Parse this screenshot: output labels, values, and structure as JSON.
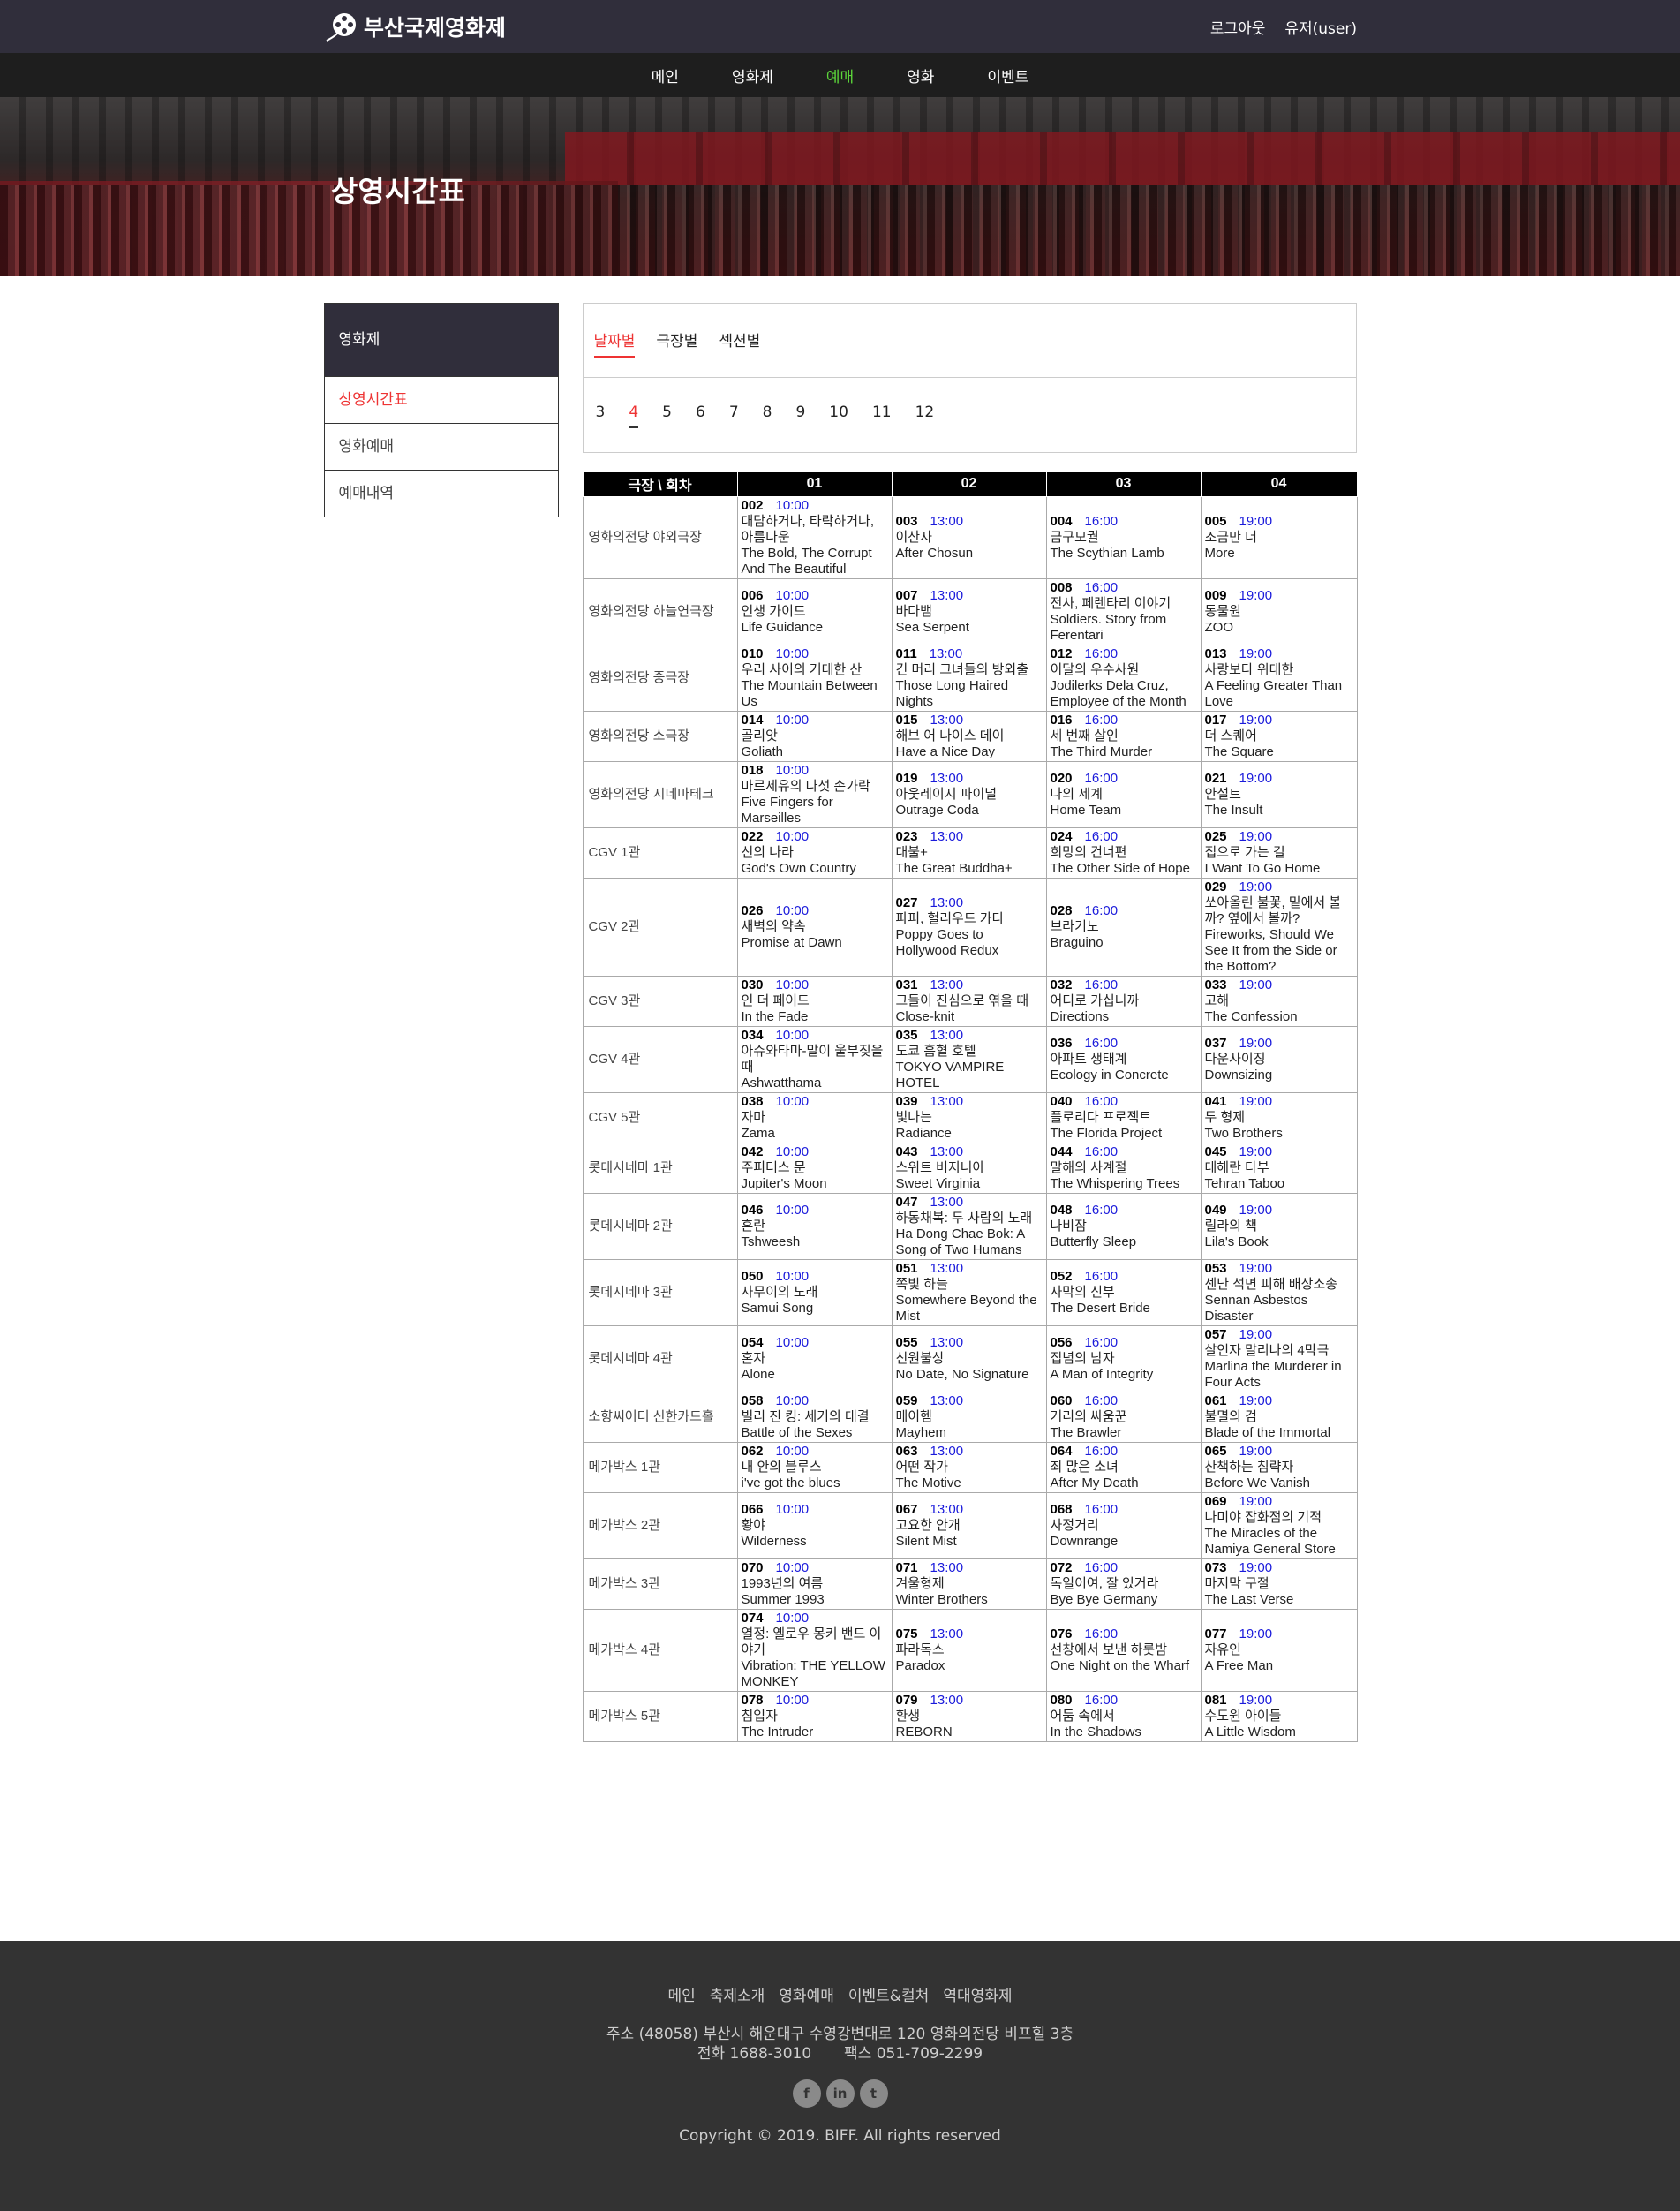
{
  "header": {
    "logo_text": "부산국제영화제",
    "logout": "로그아웃",
    "user": "유저(user)"
  },
  "nav": [
    "메인",
    "영화제",
    "예매",
    "영화",
    "이벤트"
  ],
  "nav_active": "예매",
  "banner_title": "상영시간표",
  "sidebar": {
    "title": "영화제",
    "items": [
      "상영시간표",
      "영화예매",
      "예매내역"
    ]
  },
  "tabs": [
    "날짜별",
    "극장별",
    "섹션별"
  ],
  "dates": [
    "3",
    "4",
    "5",
    "6",
    "7",
    "8",
    "9",
    "10",
    "11",
    "12"
  ],
  "schedule": {
    "headers": [
      "극장 \\ 회차",
      "01",
      "02",
      "03",
      "04"
    ],
    "rows": [
      {
        "theater": "영화의전당 야외극장",
        "cells": [
          {
            "code": "002",
            "time": "10:00",
            "ko": "대담하거나, 타락하거나, 아름다운",
            "en": "The Bold, The Corrupt And The Beautiful"
          },
          {
            "code": "003",
            "time": "13:00",
            "ko": "이산자",
            "en": "After Chosun"
          },
          {
            "code": "004",
            "time": "16:00",
            "ko": "금구모궐",
            "en": "The Scythian Lamb"
          },
          {
            "code": "005",
            "time": "19:00",
            "ko": "조금만 더",
            "en": "More"
          }
        ]
      },
      {
        "theater": "영화의전당 하늘연극장",
        "cells": [
          {
            "code": "006",
            "time": "10:00",
            "ko": "인생 가이드",
            "en": "Life Guidance"
          },
          {
            "code": "007",
            "time": "13:00",
            "ko": "바다뱀",
            "en": "Sea Serpent"
          },
          {
            "code": "008",
            "time": "16:00",
            "ko": "전사, 페렌타리 이야기",
            "en": "Soldiers. Story from Ferentari"
          },
          {
            "code": "009",
            "time": "19:00",
            "ko": "동물원",
            "en": "ZOO"
          }
        ]
      },
      {
        "theater": "영화의전당 중극장",
        "cells": [
          {
            "code": "010",
            "time": "10:00",
            "ko": "우리 사이의 거대한 산",
            "en": "The Mountain Between Us"
          },
          {
            "code": "011",
            "time": "13:00",
            "ko": "긴 머리 그녀들의 방외출",
            "en": "Those Long Haired Nights"
          },
          {
            "code": "012",
            "time": "16:00",
            "ko": "이달의 우수사원",
            "en": "Jodilerks Dela Cruz, Employee of the Month"
          },
          {
            "code": "013",
            "time": "19:00",
            "ko": "사랑보다 위대한",
            "en": "A Feeling Greater Than Love"
          }
        ]
      },
      {
        "theater": "영화의전당 소극장",
        "cells": [
          {
            "code": "014",
            "time": "10:00",
            "ko": "골리앗",
            "en": "Goliath"
          },
          {
            "code": "015",
            "time": "13:00",
            "ko": "해브 어 나이스 데이",
            "en": "Have a Nice Day"
          },
          {
            "code": "016",
            "time": "16:00",
            "ko": "세 번째 살인",
            "en": "The Third Murder"
          },
          {
            "code": "017",
            "time": "19:00",
            "ko": "더 스퀘어",
            "en": "The Square"
          }
        ]
      },
      {
        "theater": "영화의전당 시네마테크",
        "cells": [
          {
            "code": "018",
            "time": "10:00",
            "ko": "마르세유의 다섯 손가락",
            "en": "Five Fingers for Marseilles"
          },
          {
            "code": "019",
            "time": "13:00",
            "ko": "아웃레이지 파이널",
            "en": "Outrage Coda"
          },
          {
            "code": "020",
            "time": "16:00",
            "ko": "나의 세계",
            "en": "Home Team"
          },
          {
            "code": "021",
            "time": "19:00",
            "ko": "안설트",
            "en": "The Insult"
          }
        ]
      },
      {
        "theater": "CGV 1관",
        "cells": [
          {
            "code": "022",
            "time": "10:00",
            "ko": "신의 나라",
            "en": "God's Own Country"
          },
          {
            "code": "023",
            "time": "13:00",
            "ko": "대불+",
            "en": "The Great Buddha+"
          },
          {
            "code": "024",
            "time": "16:00",
            "ko": "희망의 건너편",
            "en": "The Other Side of Hope"
          },
          {
            "code": "025",
            "time": "19:00",
            "ko": "집으로 가는 길",
            "en": "I Want To Go Home"
          }
        ]
      },
      {
        "theater": "CGV 2관",
        "cells": [
          {
            "code": "026",
            "time": "10:00",
            "ko": "새벽의 약속",
            "en": "Promise at Dawn"
          },
          {
            "code": "027",
            "time": "13:00",
            "ko": "파피, 헐리우드 가다",
            "en": "Poppy Goes to Hollywood Redux"
          },
          {
            "code": "028",
            "time": "16:00",
            "ko": "브라기노",
            "en": "Braguino"
          },
          {
            "code": "029",
            "time": "19:00",
            "ko": "쏘아올린 불꽃, 밑에서 볼까? 옆에서 볼까?",
            "en": "Fireworks, Should We See It from the Side or the Bottom?"
          }
        ]
      },
      {
        "theater": "CGV 3관",
        "cells": [
          {
            "code": "030",
            "time": "10:00",
            "ko": "인 더 페이드",
            "en": "In the Fade"
          },
          {
            "code": "031",
            "time": "13:00",
            "ko": "그들이 진심으로 엮을 때",
            "en": "Close-knit"
          },
          {
            "code": "032",
            "time": "16:00",
            "ko": "어디로 가십니까",
            "en": "Directions"
          },
          {
            "code": "033",
            "time": "19:00",
            "ko": "고해",
            "en": "The Confession"
          }
        ]
      },
      {
        "theater": "CGV 4관",
        "cells": [
          {
            "code": "034",
            "time": "10:00",
            "ko": "아슈와타마-말이 울부짖을 때",
            "en": "Ashwatthama"
          },
          {
            "code": "035",
            "time": "13:00",
            "ko": "도쿄 흡혈 호텔",
            "en": "TOKYO VAMPIRE HOTEL"
          },
          {
            "code": "036",
            "time": "16:00",
            "ko": "아파트 생태계",
            "en": "Ecology in Concrete"
          },
          {
            "code": "037",
            "time": "19:00",
            "ko": "다운사이징",
            "en": "Downsizing"
          }
        ]
      },
      {
        "theater": "CGV 5관",
        "cells": [
          {
            "code": "038",
            "time": "10:00",
            "ko": "자마",
            "en": "Zama"
          },
          {
            "code": "039",
            "time": "13:00",
            "ko": "빛나는",
            "en": "Radiance"
          },
          {
            "code": "040",
            "time": "16:00",
            "ko": "플로리다 프로젝트",
            "en": "The Florida Project"
          },
          {
            "code": "041",
            "time": "19:00",
            "ko": "두 형제",
            "en": "Two Brothers"
          }
        ]
      },
      {
        "theater": "롯데시네마 1관",
        "cells": [
          {
            "code": "042",
            "time": "10:00",
            "ko": "주피터스 문",
            "en": "Jupiter's Moon"
          },
          {
            "code": "043",
            "time": "13:00",
            "ko": "스위트 버지니아",
            "en": "Sweet Virginia"
          },
          {
            "code": "044",
            "time": "16:00",
            "ko": "말해의 사계절",
            "en": "The Whispering Trees"
          },
          {
            "code": "045",
            "time": "19:00",
            "ko": "테헤란 타부",
            "en": "Tehran Taboo"
          }
        ]
      },
      {
        "theater": "롯데시네마 2관",
        "cells": [
          {
            "code": "046",
            "time": "10:00",
            "ko": "혼란",
            "en": "Tshweesh"
          },
          {
            "code": "047",
            "time": "13:00",
            "ko": "하동채복: 두 사람의 노래",
            "en": "Ha Dong Chae Bok: A Song of Two Humans"
          },
          {
            "code": "048",
            "time": "16:00",
            "ko": "나비잠",
            "en": "Butterfly Sleep"
          },
          {
            "code": "049",
            "time": "19:00",
            "ko": "릴라의 책",
            "en": "Lila's Book"
          }
        ]
      },
      {
        "theater": "롯데시네마 3관",
        "cells": [
          {
            "code": "050",
            "time": "10:00",
            "ko": "사무이의 노래",
            "en": "Samui Song"
          },
          {
            "code": "051",
            "time": "13:00",
            "ko": "쪽빛 하늘",
            "en": "Somewhere Beyond the Mist"
          },
          {
            "code": "052",
            "time": "16:00",
            "ko": "사막의 신부",
            "en": "The Desert Bride"
          },
          {
            "code": "053",
            "time": "19:00",
            "ko": "센난 석면 피해 배상소송",
            "en": "Sennan Asbestos Disaster"
          }
        ]
      },
      {
        "theater": "롯데시네마 4관",
        "cells": [
          {
            "code": "054",
            "time": "10:00",
            "ko": "혼자",
            "en": "Alone"
          },
          {
            "code": "055",
            "time": "13:00",
            "ko": "신원불상",
            "en": "No Date, No Signature"
          },
          {
            "code": "056",
            "time": "16:00",
            "ko": "집념의 남자",
            "en": "A Man of Integrity"
          },
          {
            "code": "057",
            "time": "19:00",
            "ko": "살인자 말리나의 4막극",
            "en": "Marlina the Murderer in Four Acts"
          }
        ]
      },
      {
        "theater": "소향씨어터 신한카드홀",
        "cells": [
          {
            "code": "058",
            "time": "10:00",
            "ko": "빌리 진 킹: 세기의 대결",
            "en": "Battle of the Sexes"
          },
          {
            "code": "059",
            "time": "13:00",
            "ko": "메이헴",
            "en": "Mayhem"
          },
          {
            "code": "060",
            "time": "16:00",
            "ko": "거리의 싸움꾼",
            "en": "The Brawler"
          },
          {
            "code": "061",
            "time": "19:00",
            "ko": "불멸의 검",
            "en": "Blade of the Immortal"
          }
        ]
      },
      {
        "theater": "메가박스 1관",
        "cells": [
          {
            "code": "062",
            "time": "10:00",
            "ko": "내 안의 블루스",
            "en": "i've got the blues"
          },
          {
            "code": "063",
            "time": "13:00",
            "ko": "어떤 작가",
            "en": "The Motive"
          },
          {
            "code": "064",
            "time": "16:00",
            "ko": "죄 많은 소녀",
            "en": "After My Death"
          },
          {
            "code": "065",
            "time": "19:00",
            "ko": "산책하는 침략자",
            "en": "Before We Vanish"
          }
        ]
      },
      {
        "theater": "메가박스 2관",
        "cells": [
          {
            "code": "066",
            "time": "10:00",
            "ko": "황야",
            "en": "Wilderness"
          },
          {
            "code": "067",
            "time": "13:00",
            "ko": "고요한 안개",
            "en": "Silent Mist"
          },
          {
            "code": "068",
            "time": "16:00",
            "ko": "사정거리",
            "en": "Downrange"
          },
          {
            "code": "069",
            "time": "19:00",
            "ko": "나미야 잡화점의 기적",
            "en": "The Miracles of the Namiya General Store"
          }
        ]
      },
      {
        "theater": "메가박스 3관",
        "cells": [
          {
            "code": "070",
            "time": "10:00",
            "ko": "1993년의 여름",
            "en": "Summer 1993"
          },
          {
            "code": "071",
            "time": "13:00",
            "ko": "겨울형제",
            "en": "Winter Brothers"
          },
          {
            "code": "072",
            "time": "16:00",
            "ko": "독일이여, 잘 있거라",
            "en": "Bye Bye Germany"
          },
          {
            "code": "073",
            "time": "19:00",
            "ko": "마지막 구절",
            "en": "The Last Verse"
          }
        ]
      },
      {
        "theater": "메가박스 4관",
        "cells": [
          {
            "code": "074",
            "time": "10:00",
            "ko": "열정: 옐로우 몽키 밴드 이야기",
            "en": "Vibration: THE YELLOW MONKEY"
          },
          {
            "code": "075",
            "time": "13:00",
            "ko": "파라독스",
            "en": "Paradox"
          },
          {
            "code": "076",
            "time": "16:00",
            "ko": "선창에서 보낸 하룻밤",
            "en": "One Night on the Wharf"
          },
          {
            "code": "077",
            "time": "19:00",
            "ko": "자유인",
            "en": "A Free Man"
          }
        ]
      },
      {
        "theater": "메가박스 5관",
        "cells": [
          {
            "code": "078",
            "time": "10:00",
            "ko": "침입자",
            "en": "The Intruder"
          },
          {
            "code": "079",
            "time": "13:00",
            "ko": "환생",
            "en": "REBORN"
          },
          {
            "code": "080",
            "time": "16:00",
            "ko": "어둠 속에서",
            "en": "In the Shadows"
          },
          {
            "code": "081",
            "time": "19:00",
            "ko": "수도원 아이들",
            "en": "A Little Wisdom"
          }
        ]
      }
    ]
  },
  "footer": {
    "links": [
      "메인",
      "축제소개",
      "영화예매",
      "이벤트&컬쳐",
      "역대영화제"
    ],
    "address": "주소 (48058) 부산시 해운대구 수영강변대로 120 영화의전당 비프힐 3층",
    "phone": "전화 1688-3010",
    "fax": "팩스 051-709-2299",
    "social": [
      {
        "icon": "facebook-icon",
        "glyph": "f"
      },
      {
        "icon": "linkedin-icon",
        "glyph": "in"
      },
      {
        "icon": "twitter-icon",
        "glyph": "t"
      }
    ],
    "copyright": "Copyright © 2019. BIFF. All rights reserved"
  },
  "colors": {
    "accent_red": "#e33333",
    "nav_active": "#5cd63a",
    "time_blue": "#1a1adb",
    "header_bg": "#302e3b"
  }
}
